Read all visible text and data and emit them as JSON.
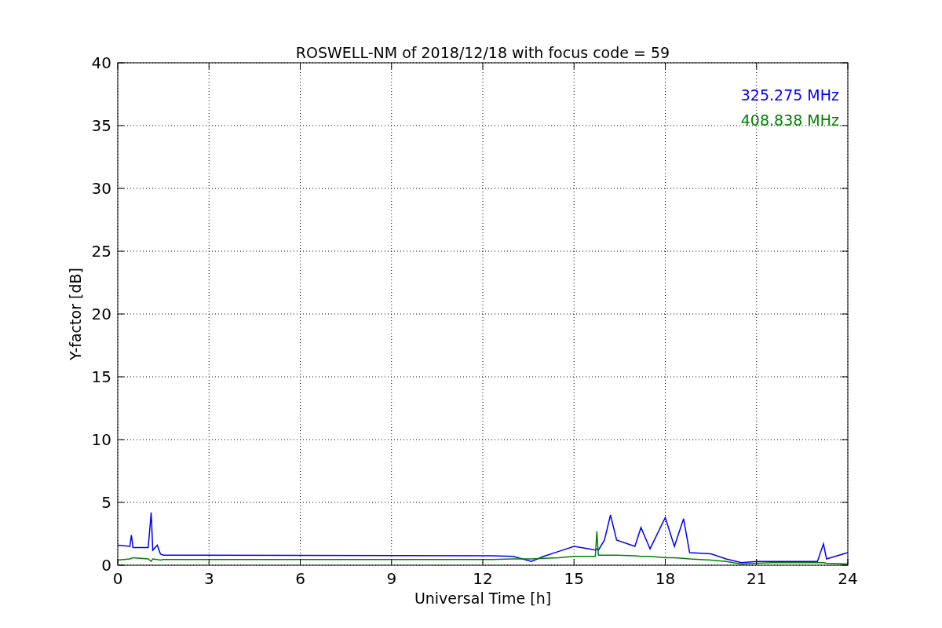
{
  "chart_data": {
    "type": "line",
    "title": "ROSWELL-NM of 2018/12/18 with focus code = 59",
    "xlabel": "Universal Time [h]",
    "ylabel": "Y-factor [dB]",
    "x": [
      0,
      0.4,
      0.45,
      0.5,
      1.0,
      1.1,
      1.15,
      1.3,
      1.4,
      1.5,
      12.3,
      13,
      13.6,
      14,
      14.5,
      15,
      15.5,
      15.7,
      15.75,
      15.8,
      16,
      16.2,
      16.4,
      17,
      17.2,
      17.5,
      18,
      18.3,
      18.6,
      18.8,
      19.5,
      20,
      20.5,
      21,
      21.5,
      22,
      23,
      23.2,
      23.3,
      24
    ],
    "series": [
      {
        "name": "325.275 MHz",
        "color": "#0000ff",
        "values": [
          1.6,
          1.5,
          2.4,
          1.4,
          1.4,
          4.2,
          1.2,
          1.6,
          0.9,
          0.8,
          0.75,
          0.7,
          0.3,
          0.7,
          1.1,
          1.5,
          1.3,
          1.2,
          1.3,
          1.2,
          2,
          4,
          2,
          1.5,
          3,
          1.3,
          3.8,
          1.5,
          3.7,
          1,
          0.9,
          0.5,
          0.2,
          0.3,
          0.3,
          0.3,
          0.3,
          1.7,
          0.5,
          1.0
        ]
      },
      {
        "name": "408.838 MHz",
        "color": "#008000",
        "values": [
          0.4,
          0.5,
          0.55,
          0.6,
          0.5,
          0.3,
          0.5,
          0.45,
          0.4,
          0.45,
          0.45,
          0.5,
          0.5,
          0.55,
          0.6,
          0.7,
          0.7,
          0.7,
          2.7,
          0.8,
          0.8,
          0.8,
          0.8,
          0.75,
          0.7,
          0.7,
          0.6,
          0.6,
          0.55,
          0.5,
          0.4,
          0.3,
          0.1,
          0.15,
          0.2,
          0.2,
          0.2,
          0.2,
          0.15,
          0.1
        ]
      }
    ],
    "grid": true,
    "xlim": [
      0,
      24
    ],
    "ylim": [
      0,
      40
    ],
    "xticks": [
      0,
      3,
      6,
      9,
      12,
      15,
      18,
      21,
      24
    ],
    "yticks": [
      0,
      5,
      10,
      15,
      20,
      25,
      30,
      35,
      40
    ]
  }
}
